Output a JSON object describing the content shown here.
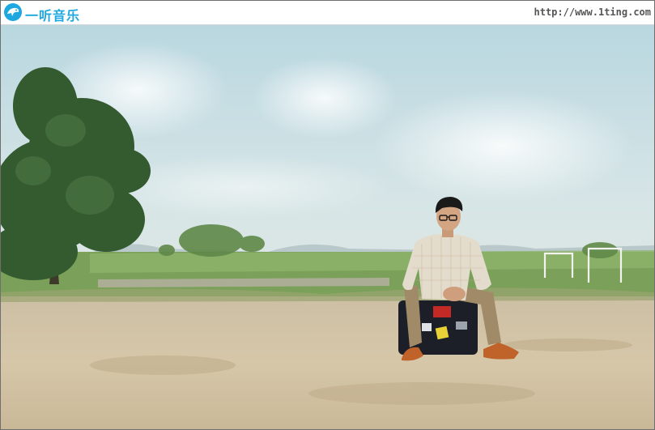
{
  "header": {
    "logo_icon": "dolphin-mascot-icon",
    "logo_text": "一听音乐",
    "site_url": "http://www.1ting.com"
  },
  "colors": {
    "brand": "#1fa8e0",
    "url_text": "#555555",
    "border": "#6f6f6f"
  }
}
